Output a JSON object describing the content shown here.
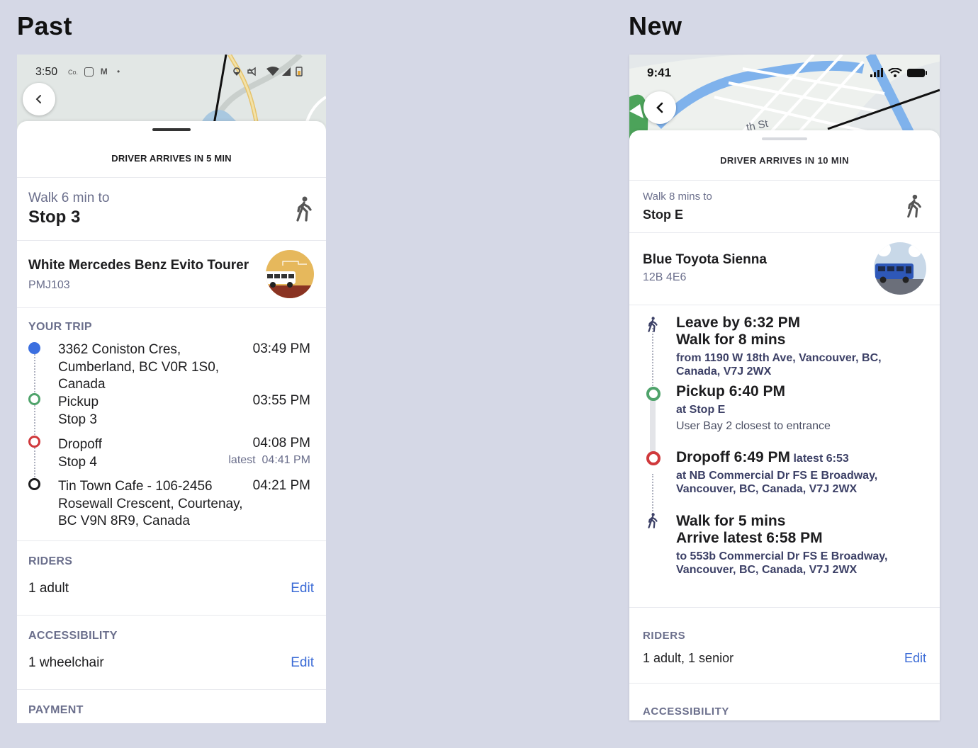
{
  "headings": {
    "past": "Past",
    "new": "New"
  },
  "past": {
    "status_time": "3:50",
    "status_carrier": "Co.",
    "driver_banner": "DRIVER ARRIVES IN 5 MIN",
    "walk": {
      "label": "Walk 6 min to",
      "stop": "Stop 3"
    },
    "vehicle": {
      "name": "White Mercedes Benz Evito Tourer",
      "plate": "PMJ103"
    },
    "trip": {
      "heading": "YOUR TRIP",
      "stops": [
        {
          "lines": [
            "3362 Coniston Cres,",
            "Cumberland, BC V0R 1S0,",
            "Canada"
          ],
          "time": "03:49 PM"
        },
        {
          "lines": [
            "Pickup",
            "Stop 3"
          ],
          "time": "03:55 PM"
        },
        {
          "lines": [
            "Dropoff",
            "Stop 4"
          ],
          "time": "04:08 PM",
          "latest_label": "latest",
          "latest_time": "04:41 PM"
        },
        {
          "lines": [
            "Tin Town Cafe - 106-2456",
            "Rosewall Crescent, Courtenay,",
            "BC V9N 8R9, Canada"
          ],
          "time": "04:21 PM"
        }
      ]
    },
    "riders": {
      "heading": "RIDERS",
      "value": "1 adult",
      "edit": "Edit"
    },
    "accessibility": {
      "heading": "ACCESSIBILITY",
      "value": "1 wheelchair",
      "edit": "Edit"
    },
    "payment": {
      "heading": "PAYMENT"
    }
  },
  "new": {
    "status_time": "9:41",
    "map_street_label": "th St",
    "driver_banner": "DRIVER ARRIVES IN 10 MIN",
    "walk": {
      "label": "Walk 8 mins to",
      "stop": "Stop E"
    },
    "vehicle": {
      "name": "Blue Toyota Sienna",
      "plate": "12B 4E6"
    },
    "steps": [
      {
        "title1": "Leave by 6:32 PM",
        "title2": "Walk for 8 mins",
        "detail1": "from 1190 W 18th Ave, Vancouver, BC,",
        "detail2": "Canada, V7J 2WX"
      },
      {
        "title1": "Pickup 6:40 PM",
        "detail1": "at Stop E",
        "note": "User Bay 2 closest to entrance"
      },
      {
        "title1": "Dropoff 6:49 PM",
        "latest": "latest 6:53",
        "detail1": "at NB Commercial Dr FS E Broadway,",
        "detail2": "Vancouver, BC, Canada, V7J 2WX"
      },
      {
        "title1": "Walk for 5 mins",
        "title2": "Arrive latest 6:58 PM",
        "detail1": "to 553b Commercial Dr FS E Broadway,",
        "detail2": "Vancouver, BC, Canada, V7J 2WX"
      }
    ],
    "riders": {
      "heading": "RIDERS",
      "value": "1 adult, 1 senior",
      "edit": "Edit"
    },
    "accessibility": {
      "heading": "ACCESSIBILITY"
    }
  },
  "colors": {
    "origin": "#3b6fe0",
    "pickup": "#4fa36b",
    "dropoff": "#d0393c",
    "destination": "#1d1d1f",
    "link": "#3b6bd6",
    "muted": "#6b6f8c"
  },
  "icons": [
    "back-chevron-icon",
    "walking-person-icon",
    "vehicle-thumbnail",
    "wifi-icon",
    "battery-icon",
    "signal-icon"
  ]
}
